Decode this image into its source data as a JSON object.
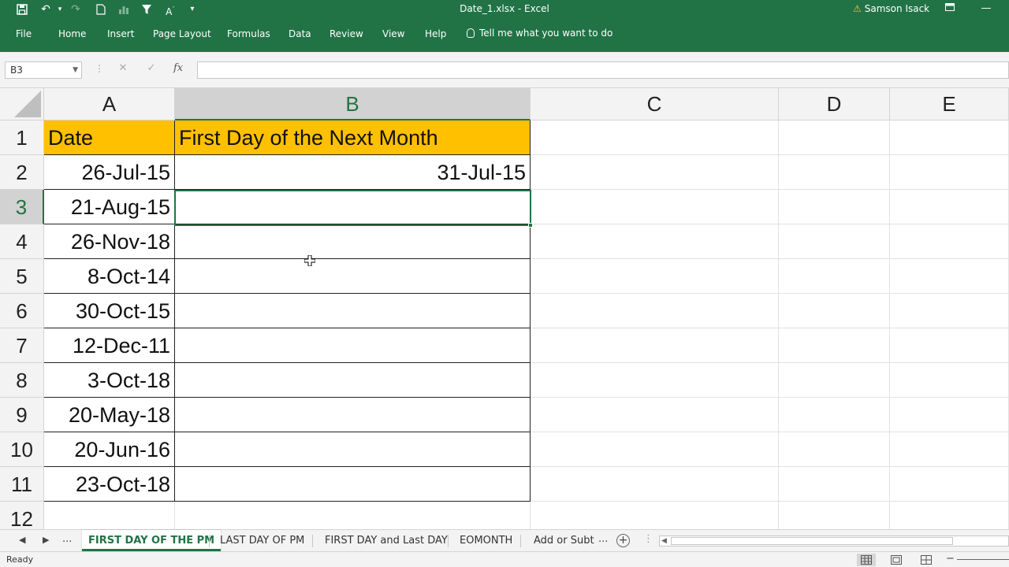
{
  "window": {
    "title": "Date_1.xlsx  -  Excel",
    "user": "Samson Isack",
    "quick_access": {
      "save_icon": "save-icon",
      "undo_icon": "undo-icon",
      "redo_icon": "redo-icon",
      "filter_icon": "filter-icon"
    }
  },
  "ribbon": {
    "tabs": [
      "File",
      "Home",
      "Insert",
      "Page Layout",
      "Formulas",
      "Data",
      "Review",
      "View",
      "Help"
    ],
    "tell_me": "Tell me what you want to do"
  },
  "formula_bar": {
    "name_box": "B3",
    "formula": ""
  },
  "grid": {
    "columns": [
      "A",
      "B",
      "C",
      "D",
      "E"
    ],
    "selected_column": "B",
    "selected_row": 3,
    "rows": [
      {
        "num": "1",
        "a": "Date",
        "b": "First Day of the Next Month"
      },
      {
        "num": "2",
        "a": "26-Jul-15",
        "b": "31-Jul-15"
      },
      {
        "num": "3",
        "a": "21-Aug-15",
        "b": ""
      },
      {
        "num": "4",
        "a": "26-Nov-18",
        "b": ""
      },
      {
        "num": "5",
        "a": "8-Oct-14",
        "b": ""
      },
      {
        "num": "6",
        "a": "30-Oct-15",
        "b": ""
      },
      {
        "num": "7",
        "a": "12-Dec-11",
        "b": ""
      },
      {
        "num": "8",
        "a": "3-Oct-18",
        "b": ""
      },
      {
        "num": "9",
        "a": "20-May-18",
        "b": ""
      },
      {
        "num": "10",
        "a": "20-Jun-16",
        "b": ""
      },
      {
        "num": "11",
        "a": "23-Oct-18",
        "b": ""
      },
      {
        "num": "12",
        "a": "",
        "b": ""
      }
    ],
    "header_fill": "#ffc000"
  },
  "sheets": {
    "nav_more": "...",
    "tabs": [
      "FIRST DAY OF THE PM",
      "LAST DAY OF PM",
      "FIRST DAY and Last DAY",
      "EOMONTH",
      "Add or Subt"
    ],
    "active": "FIRST DAY OF THE PM",
    "more": "..."
  },
  "status": {
    "text": "Ready"
  },
  "colors": {
    "excel_green": "#217346",
    "header_gold": "#ffc000"
  }
}
